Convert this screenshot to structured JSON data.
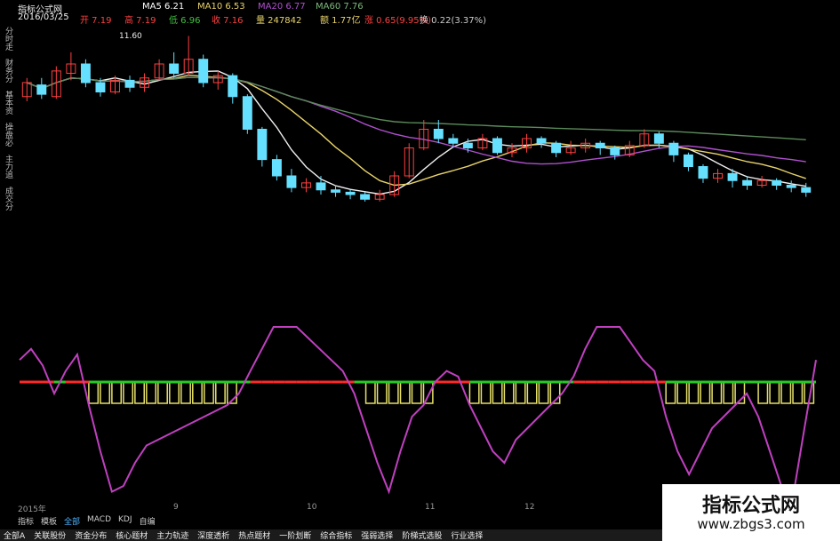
{
  "header": {
    "title": "指标公式网",
    "date": "2016/03/25",
    "ma5": "MA5 6.21",
    "ma10": "MA10 6.53",
    "ma20": "MA20 6.77",
    "ma60": "MA60 7.76",
    "open": "开 7.19",
    "high": "高 7.19",
    "low": "低 6.96",
    "close": "收 7.16",
    "volume": "量 247842",
    "amount": "额 1.77亿",
    "change": "涨 0.65(9.95%)",
    "turnover": "换 0.22(3.37%)",
    "peak_label": "11.60"
  },
  "left_axis": [
    "分时走势",
    "财务分析",
    "基本资料",
    "操盘必读",
    "主力追踪",
    "成交分析"
  ],
  "x_ticks": [
    "2015年",
    "9",
    "10",
    "11",
    "12"
  ],
  "tabs": [
    "指标",
    "模板",
    "全部",
    "MACD",
    "KDJ",
    "自编"
  ],
  "tabs_selected": 2,
  "bottom_tabs": [
    "全部A",
    "关联股份",
    "资金分布",
    "核心题材",
    "主力轨迹",
    "深度透析",
    "热点题材",
    "一阶划断",
    "综合指标",
    "强弱选择",
    "阶梯式选股",
    "行业选择"
  ],
  "watermark": {
    "line1": "指标公式网",
    "line2": "www.zbgs3.com"
  },
  "colors": {
    "up": "#ff4040",
    "down": "#66e0ff",
    "ma5": "#f0f0f0",
    "ma10": "#e8d36a",
    "ma20": "#b050d0",
    "ma60": "#5a8a5a",
    "osc": "#c040c0",
    "zero_up": "#ff2a2a",
    "zero_down": "#22cc22",
    "hist": "#e6e06a"
  },
  "chart_data": [
    {
      "type": "candlestick",
      "title": "",
      "note": "price panel, values approximate; screen y-inverted",
      "ylim": [
        4,
        12
      ],
      "candles": [
        [
          9.0,
          9.6,
          8.8,
          9.8
        ],
        [
          9.5,
          9.1,
          8.9,
          9.8
        ],
        [
          9.0,
          10.1,
          8.9,
          10.3
        ],
        [
          10.0,
          10.4,
          9.7,
          10.9
        ],
        [
          10.4,
          9.6,
          9.4,
          10.6
        ],
        [
          9.6,
          9.2,
          9.0,
          9.8
        ],
        [
          9.2,
          9.7,
          9.1,
          9.9
        ],
        [
          9.7,
          9.4,
          9.2,
          9.9
        ],
        [
          9.4,
          9.8,
          9.2,
          10.0
        ],
        [
          9.8,
          10.4,
          9.7,
          10.6
        ],
        [
          10.4,
          10.0,
          9.8,
          10.9
        ],
        [
          10.0,
          10.6,
          9.9,
          11.6
        ],
        [
          10.6,
          9.6,
          9.4,
          10.8
        ],
        [
          9.6,
          9.9,
          9.3,
          10.1
        ],
        [
          9.9,
          9.0,
          8.7,
          10.0
        ],
        [
          9.0,
          7.6,
          7.4,
          9.1
        ],
        [
          7.6,
          6.3,
          6.0,
          7.7
        ],
        [
          6.3,
          5.6,
          5.4,
          6.5
        ],
        [
          5.6,
          5.1,
          4.9,
          5.9
        ],
        [
          5.1,
          5.3,
          4.9,
          5.5
        ],
        [
          5.3,
          5.0,
          4.8,
          5.6
        ],
        [
          5.0,
          4.9,
          4.7,
          5.2
        ],
        [
          4.9,
          4.8,
          4.6,
          5.0
        ],
        [
          4.8,
          4.6,
          4.5,
          4.9
        ],
        [
          4.6,
          4.8,
          4.5,
          5.0
        ],
        [
          4.8,
          5.6,
          4.7,
          5.8
        ],
        [
          5.6,
          6.8,
          5.5,
          7.0
        ],
        [
          6.8,
          7.6,
          6.7,
          8.0
        ],
        [
          7.6,
          7.2,
          7.0,
          8.0
        ],
        [
          7.2,
          7.0,
          6.8,
          7.4
        ],
        [
          7.0,
          6.8,
          6.6,
          7.2
        ],
        [
          6.8,
          7.2,
          6.7,
          7.4
        ],
        [
          7.2,
          6.6,
          6.5,
          7.3
        ],
        [
          6.6,
          6.8,
          6.4,
          7.0
        ],
        [
          6.8,
          7.2,
          6.6,
          7.4
        ],
        [
          7.2,
          7.0,
          6.8,
          7.3
        ],
        [
          7.0,
          6.6,
          6.4,
          7.1
        ],
        [
          6.6,
          6.8,
          6.5,
          7.1
        ],
        [
          6.8,
          7.0,
          6.6,
          7.2
        ],
        [
          7.0,
          6.8,
          6.5,
          7.1
        ],
        [
          6.8,
          6.5,
          6.3,
          6.9
        ],
        [
          6.5,
          6.9,
          6.4,
          7.1
        ],
        [
          6.9,
          7.4,
          6.8,
          7.6
        ],
        [
          7.4,
          7.0,
          6.8,
          7.5
        ],
        [
          7.0,
          6.5,
          6.2,
          7.1
        ],
        [
          6.5,
          6.0,
          5.8,
          6.6
        ],
        [
          6.0,
          5.5,
          5.3,
          6.1
        ],
        [
          5.5,
          5.7,
          5.3,
          5.9
        ],
        [
          5.7,
          5.4,
          5.1,
          5.9
        ],
        [
          5.4,
          5.2,
          5.0,
          5.6
        ],
        [
          5.2,
          5.4,
          5.1,
          5.6
        ],
        [
          5.4,
          5.2,
          5.0,
          5.5
        ],
        [
          5.2,
          5.1,
          4.9,
          5.4
        ],
        [
          5.1,
          4.9,
          4.7,
          5.3
        ]
      ]
    },
    {
      "type": "line",
      "title": "",
      "note": "oscillator panel with zero line and signal histogram",
      "ylim": [
        -100,
        100
      ],
      "series": [
        {
          "name": "",
          "values": [
            40,
            60,
            30,
            -10,
            20,
            50,
            -20,
            -60,
            -95,
            -90,
            -70,
            -55,
            -50,
            -45,
            -40,
            -35,
            -30,
            -25,
            -20,
            -10,
            20,
            60,
            100,
            100,
            100,
            80,
            60,
            40,
            20,
            -10,
            -40,
            -70,
            -95,
            -60,
            -30,
            -20,
            0,
            20,
            10,
            -20,
            -40,
            -60,
            -70,
            -50,
            -40,
            -30,
            -20,
            -10,
            10,
            60,
            100,
            100,
            100,
            70,
            40,
            20,
            -30,
            -60,
            -80,
            -60,
            -40,
            -30,
            -20,
            -10,
            -30,
            -60,
            -90,
            -100,
            -40,
            40
          ]
        }
      ]
    }
  ]
}
